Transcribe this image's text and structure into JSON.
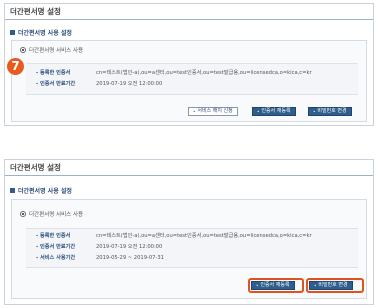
{
  "panel1": {
    "page_title": "더간편서명 설정",
    "section_title": "더간편서명 사용 설정",
    "radio_label": "더간편서명 서비스 사용",
    "step_number": "7",
    "rows": [
      {
        "label": "등록한 인증서",
        "value": "cn=테스트(법인-a),ou=a센터,ou=test인증서,ou=test발급용,ou=licensedca,o=kica,c=kr"
      },
      {
        "label": "인증서 만료기간",
        "value": "2019-07-19 오전 12:00:00"
      }
    ],
    "buttons": {
      "cancel_service": "서비스 해지 신청",
      "reregister_cert": "인증서 재등록",
      "change_password": "비밀번호 변경"
    }
  },
  "panel2": {
    "page_title": "더간편서명 설정",
    "section_title": "더간편서명 사용 설정",
    "radio_label": "더간편서명 서비스 사용",
    "rows": [
      {
        "label": "등록한 인증서",
        "value": "cn=테스트(법인-a),ou=a센터,ou=test인증서,ou=test발급용,ou=licensedca,o=kica,c=kr"
      },
      {
        "label": "인증서 만료기간",
        "value": "2019-07-19 오전 12:00:00"
      },
      {
        "label": "서비스 사용기간",
        "value": "2019-05-29 ~ 2019-07-31"
      }
    ],
    "buttons": {
      "reregister_cert": "인증서 재등록",
      "change_password": "비밀번호 변경"
    }
  },
  "colors": {
    "accent": "#2f5d8c",
    "highlight": "#e0531f",
    "badge": "#e85a1e"
  }
}
